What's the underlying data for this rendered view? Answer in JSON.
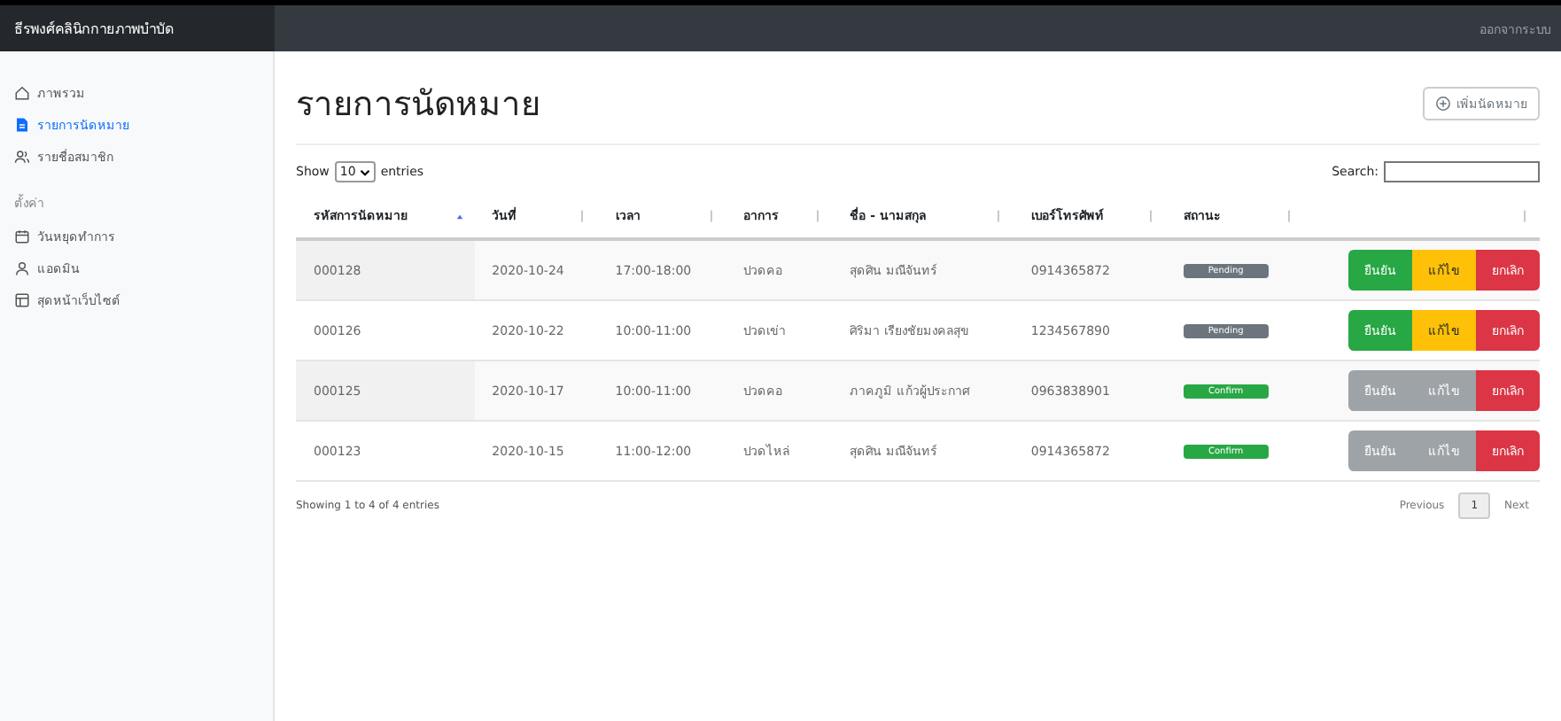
{
  "navbar": {
    "brand": "ธีรพงศ์คลินิกกายภาพบำบัด",
    "user_link": "ออกจากระบบ"
  },
  "sidebar": {
    "items": [
      {
        "label": "ภาพรวม",
        "kind": "home",
        "selected": false
      },
      {
        "label": "รายการนัดหมาย",
        "kind": "file",
        "selected": true
      },
      {
        "label": "รายชื่อสมาชิก",
        "kind": "users",
        "selected": false
      }
    ],
    "section": "ตั้งค่า",
    "settings": [
      {
        "label": "วันหยุดทำการ",
        "kind": "calendar",
        "selected": false
      },
      {
        "label": "แอดมิน",
        "kind": "user",
        "selected": false
      },
      {
        "label": "สุดหน้าเว็บไซต์",
        "kind": "layout",
        "selected": false
      }
    ]
  },
  "page_title": "รายการนัดหมาย",
  "add_button": "เพิ่มนัดหมาย",
  "length": {
    "show": "Show",
    "value": "10",
    "entries": "entries"
  },
  "search": {
    "label": "Search:"
  },
  "table": {
    "columns": [
      {
        "label": "รหัสการนัดหมาย",
        "sorted": true
      },
      {
        "label": "วันที่",
        "sorted": false
      },
      {
        "label": "เวลา",
        "sorted": false
      },
      {
        "label": "อาการ",
        "sorted": false
      },
      {
        "label": "ชื่อ - นามสกุล",
        "sorted": false
      },
      {
        "label": "เบอร์โทรศัพท์",
        "sorted": false
      },
      {
        "label": "สถานะ",
        "sorted": false
      },
      {
        "sorted": false
      }
    ],
    "rows": [
      {
        "id": "000128",
        "date": "2020-10-24",
        "time": "17:00-18:00",
        "symptom": "ปวดคอ",
        "name": "สุดศิน มณีจันทร์",
        "phone": "0914365872",
        "status": {
          "label": "Pending",
          "kind": "pending"
        },
        "actions": [
          {
            "label": "ยืนยัน",
            "kind": "confirm",
            "disabled": false
          },
          {
            "label": "แก้ไข",
            "kind": "edit",
            "disabled": false
          },
          {
            "label": "ยกเลิก",
            "kind": "cancel",
            "disabled": false
          }
        ]
      },
      {
        "id": "000126",
        "date": "2020-10-22",
        "time": "10:00-11:00",
        "symptom": "ปวดเข่า",
        "name": "ศิริมา เรียงชัยมงคลสุข",
        "phone": "1234567890",
        "status": {
          "label": "Pending",
          "kind": "pending"
        },
        "actions": [
          {
            "label": "ยืนยัน",
            "kind": "confirm",
            "disabled": false
          },
          {
            "label": "แก้ไข",
            "kind": "edit",
            "disabled": false
          },
          {
            "label": "ยกเลิก",
            "kind": "cancel",
            "disabled": false
          }
        ]
      },
      {
        "id": "000125",
        "date": "2020-10-17",
        "time": "10:00-11:00",
        "symptom": "ปวดคอ",
        "name": "ภาคภูมิ แก้วผู้ประกาศ",
        "phone": "0963838901",
        "status": {
          "label": "Confirm",
          "kind": "confirm"
        },
        "actions": [
          {
            "label": "ยืนยัน",
            "kind": "confirm",
            "disabled": true
          },
          {
            "label": "แก้ไข",
            "kind": "edit",
            "disabled": true
          },
          {
            "label": "ยกเลิก",
            "kind": "cancel",
            "disabled": false
          }
        ]
      },
      {
        "id": "000123",
        "date": "2020-10-15",
        "time": "11:00-12:00",
        "symptom": "ปวดไหล่",
        "name": "สุดศิน มณีจันทร์",
        "phone": "0914365872",
        "status": {
          "label": "Confirm",
          "kind": "confirm"
        },
        "actions": [
          {
            "label": "ยืนยัน",
            "kind": "confirm",
            "disabled": true
          },
          {
            "label": "แก้ไข",
            "kind": "edit",
            "disabled": true
          },
          {
            "label": "ยกเลิก",
            "kind": "cancel",
            "disabled": false
          }
        ]
      }
    ]
  },
  "info": "Showing 1 to 4 of 4 entries",
  "pagination": [
    {
      "label": "Previous",
      "selected": false
    },
    {
      "label": "1",
      "selected": true
    },
    {
      "label": "Next",
      "selected": false
    }
  ]
}
